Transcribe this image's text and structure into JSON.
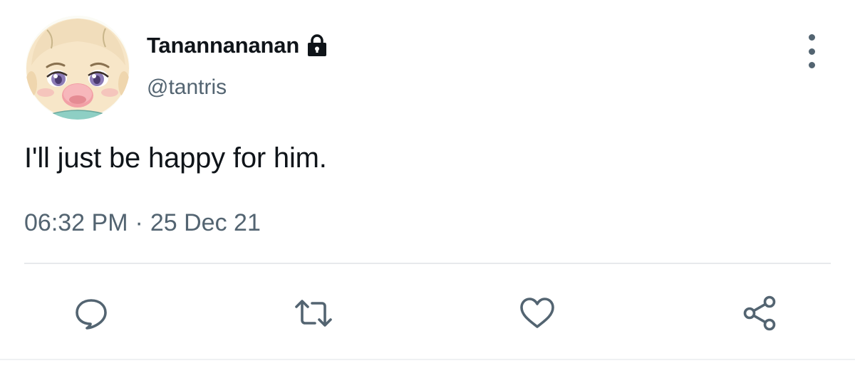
{
  "tweet": {
    "author": {
      "display_name": "Tanannananan",
      "handle": "@tantris",
      "protected_icon": "lock-icon"
    },
    "text": "I'll just be happy for him.",
    "time": "06:32 PM",
    "separator": "·",
    "date": "25 Dec 21",
    "more_icon": "more-vertical-icon"
  },
  "actions": [
    {
      "name": "reply",
      "icon": "comment-bubble-icon"
    },
    {
      "name": "retweet",
      "icon": "retweet-icon"
    },
    {
      "name": "like",
      "icon": "heart-icon"
    },
    {
      "name": "share",
      "icon": "share-icon"
    }
  ],
  "colors": {
    "text_primary": "#0f1419",
    "text_secondary": "#536471",
    "divider": "#e7e9ec"
  }
}
